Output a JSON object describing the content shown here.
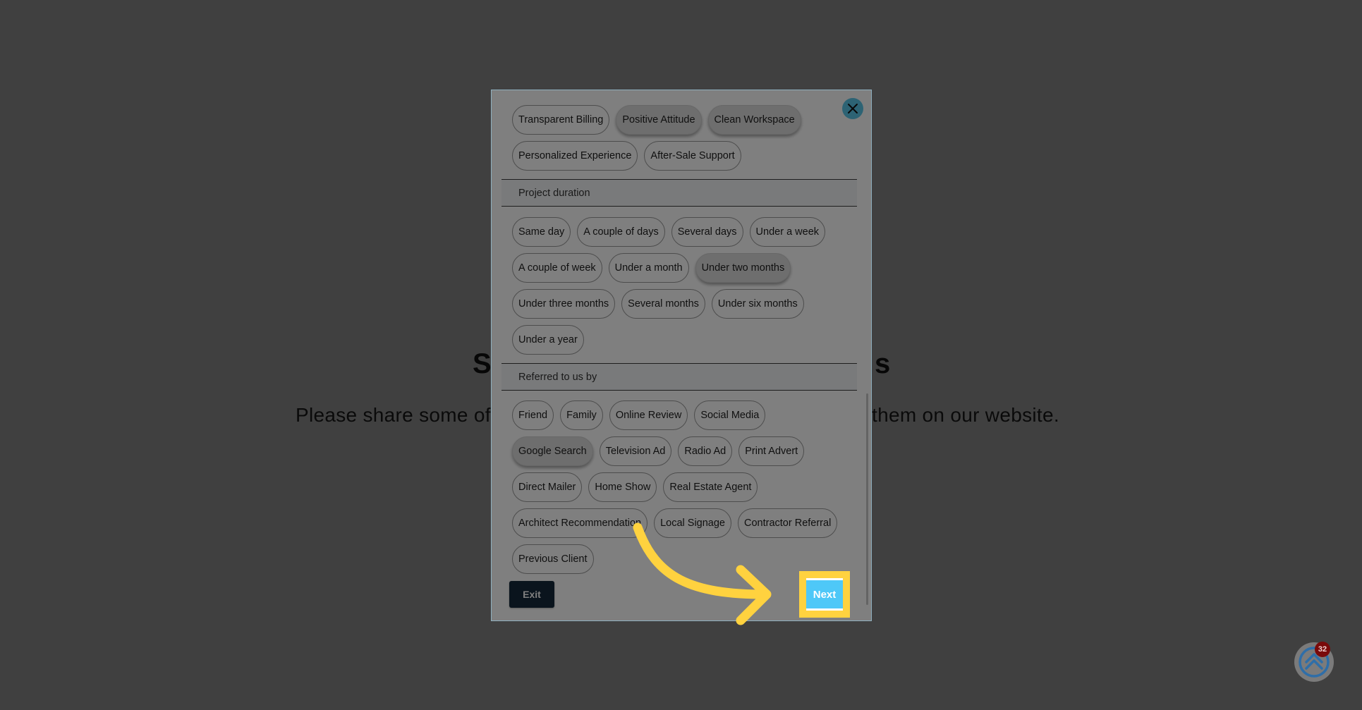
{
  "background": {
    "title_visible_left": "S",
    "title_visible_right": "s",
    "subtitle_left": "Please share some of",
    "subtitle_right": "them on our website."
  },
  "modal": {
    "close_label": "Close",
    "top_chips": [
      {
        "label": "Transparent Billing",
        "selected": false
      },
      {
        "label": "Positive Attitude",
        "selected": true
      },
      {
        "label": "Clean Workspace",
        "selected": true
      },
      {
        "label": "Personalized Experience",
        "selected": false
      },
      {
        "label": "After-Sale Support",
        "selected": false
      }
    ],
    "sections": [
      {
        "title": "Project duration",
        "chips": [
          {
            "label": "Same day",
            "selected": false
          },
          {
            "label": "A couple of days",
            "selected": false
          },
          {
            "label": "Several days",
            "selected": false
          },
          {
            "label": "Under a week",
            "selected": false
          },
          {
            "label": "A couple of week",
            "selected": false
          },
          {
            "label": "Under a month",
            "selected": false
          },
          {
            "label": "Under two months",
            "selected": true
          },
          {
            "label": "Under three months",
            "selected": false
          },
          {
            "label": "Several months",
            "selected": false
          },
          {
            "label": "Under six months",
            "selected": false
          },
          {
            "label": "Under a year",
            "selected": false
          }
        ]
      },
      {
        "title": "Referred to us by",
        "chips": [
          {
            "label": "Friend",
            "selected": false
          },
          {
            "label": "Family",
            "selected": false
          },
          {
            "label": "Online Review",
            "selected": false
          },
          {
            "label": "Social Media",
            "selected": false
          },
          {
            "label": "Google Search",
            "selected": true
          },
          {
            "label": "Television Ad",
            "selected": false
          },
          {
            "label": "Radio Ad",
            "selected": false
          },
          {
            "label": "Print Advert",
            "selected": false
          },
          {
            "label": "Direct Mailer",
            "selected": false
          },
          {
            "label": "Home Show",
            "selected": false
          },
          {
            "label": "Real Estate Agent",
            "selected": false
          },
          {
            "label": "Architect Recommendation",
            "selected": false
          },
          {
            "label": "Local Signage",
            "selected": false
          },
          {
            "label": "Contractor Referral",
            "selected": false
          },
          {
            "label": "Previous Client",
            "selected": false
          }
        ]
      }
    ],
    "exit_label": "Exit",
    "next_label": "Next"
  },
  "widget": {
    "icon": "double-chevron-up-icon",
    "badge_count": "32"
  },
  "colors": {
    "accent_next": "#4ec8f8",
    "highlight": "#ffd23f",
    "close_button": "#5bc6e8",
    "exit_button": "#14283a",
    "badge": "#7a0a0a"
  }
}
